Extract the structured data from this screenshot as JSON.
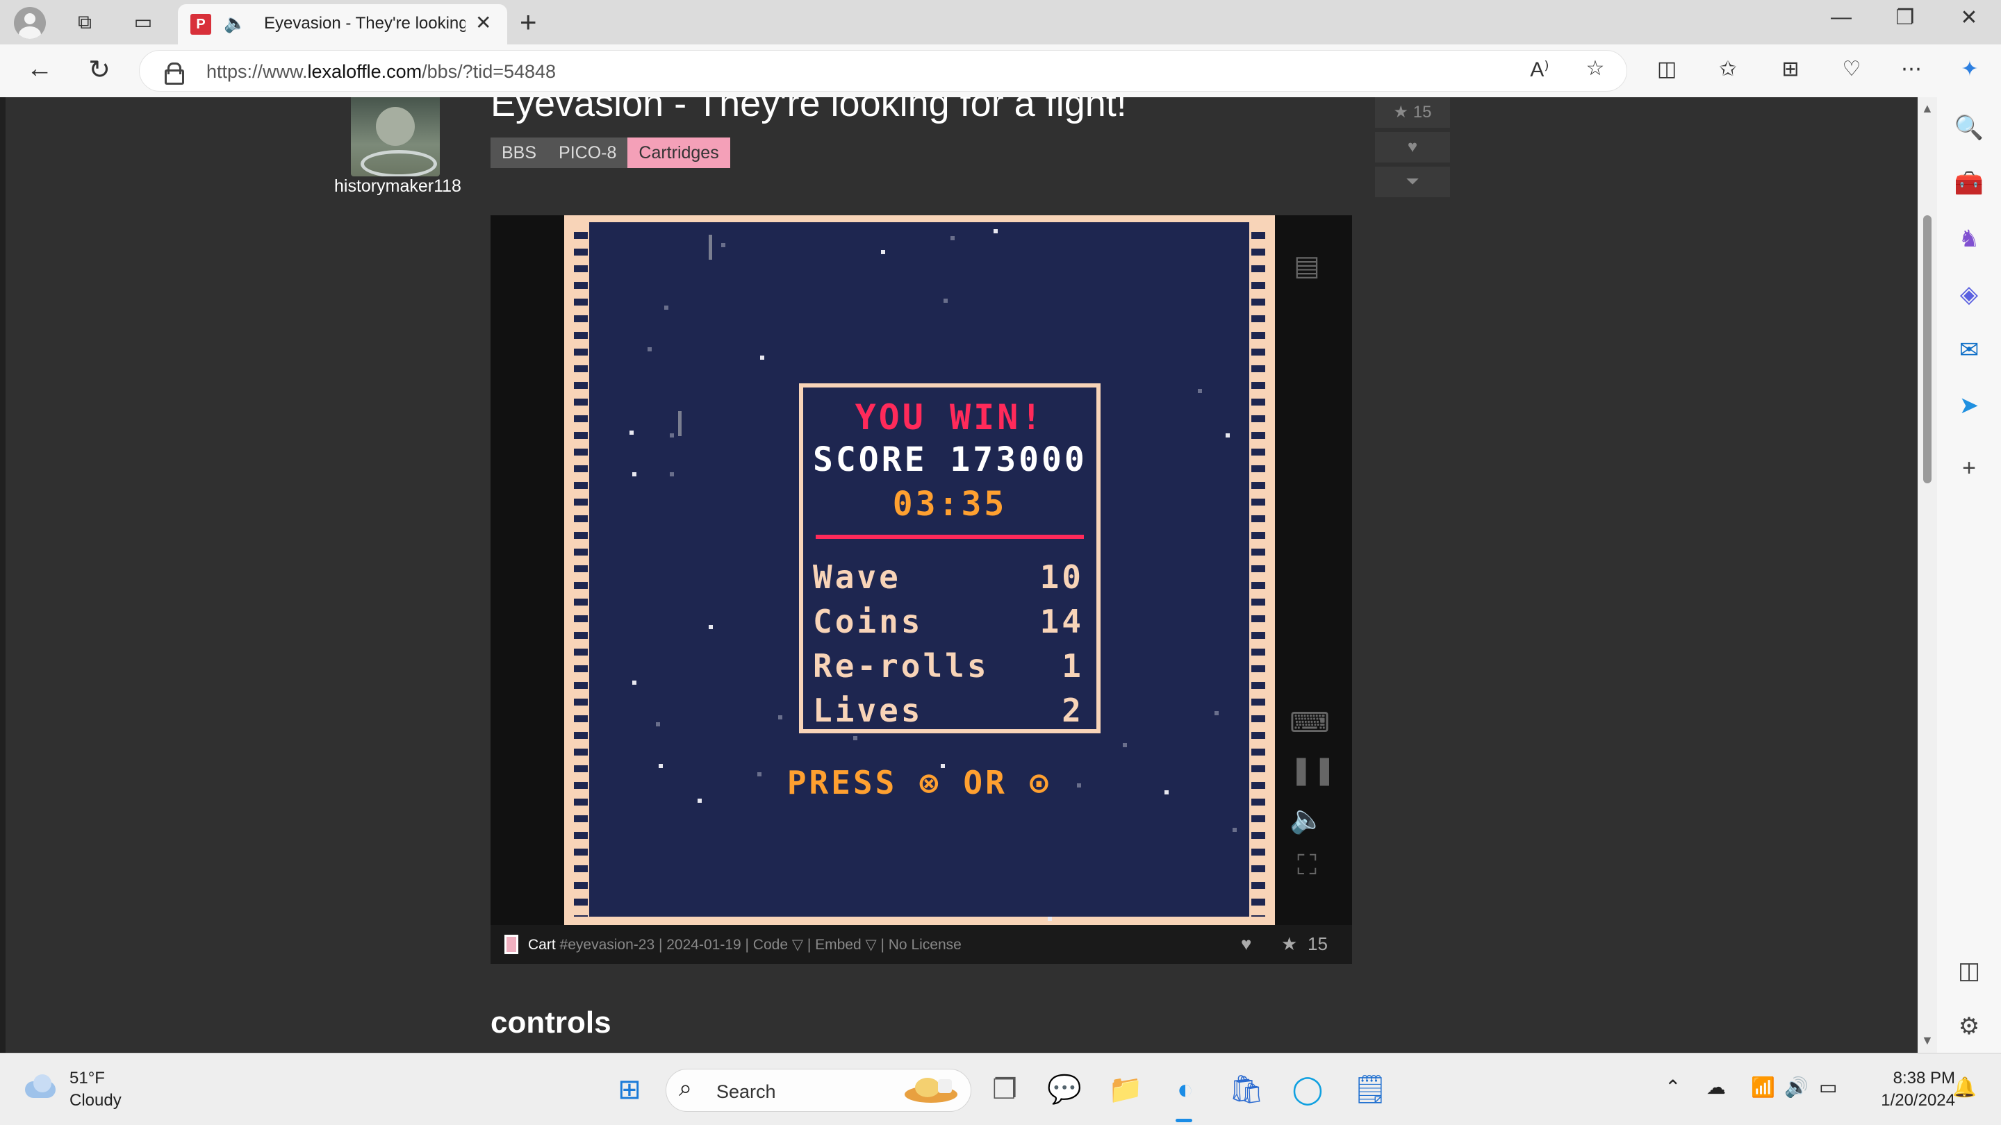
{
  "browser": {
    "tab_title": "Eyevasion - They're looking for a fight!",
    "tab_favicon_letter": "P",
    "url_prefix": "https://www.",
    "url_domain": "lexaloffle.com",
    "url_path": "/bbs/?tid=54848"
  },
  "post": {
    "username": "historymaker118",
    "title": "Eyevasion - They're looking for a fight!",
    "tags": [
      "BBS",
      "PICO-8",
      "Cartridges"
    ],
    "star_count": "15"
  },
  "game": {
    "headline": "YOU WIN!",
    "score_label": "SCORE",
    "score_value": "173000",
    "time": "03:35",
    "stats": [
      {
        "label": "Wave",
        "value": "10"
      },
      {
        "label": "Coins",
        "value": "14"
      },
      {
        "label": "Re-rolls",
        "value": "1"
      },
      {
        "label": "Lives",
        "value": "2"
      }
    ],
    "prompt": "PRESS ⊗ OR ⊙",
    "colors": {
      "headline": "#ff2a5a",
      "time": "#ffa030",
      "text": "#f8d4b8",
      "bg": "#1e2650"
    }
  },
  "cart_bar": {
    "cart_label": "Cart",
    "cart_id": "#eyevasion-23",
    "date": "2024-01-19",
    "code_label": "Code ▽",
    "embed_label": "Embed ▽",
    "license": "No License",
    "stars": "15"
  },
  "section_heading": "controls",
  "taskbar": {
    "temperature": "51°F",
    "condition": "Cloudy",
    "search_label": "Search",
    "time": "8:38 PM",
    "date": "1/20/2024"
  }
}
